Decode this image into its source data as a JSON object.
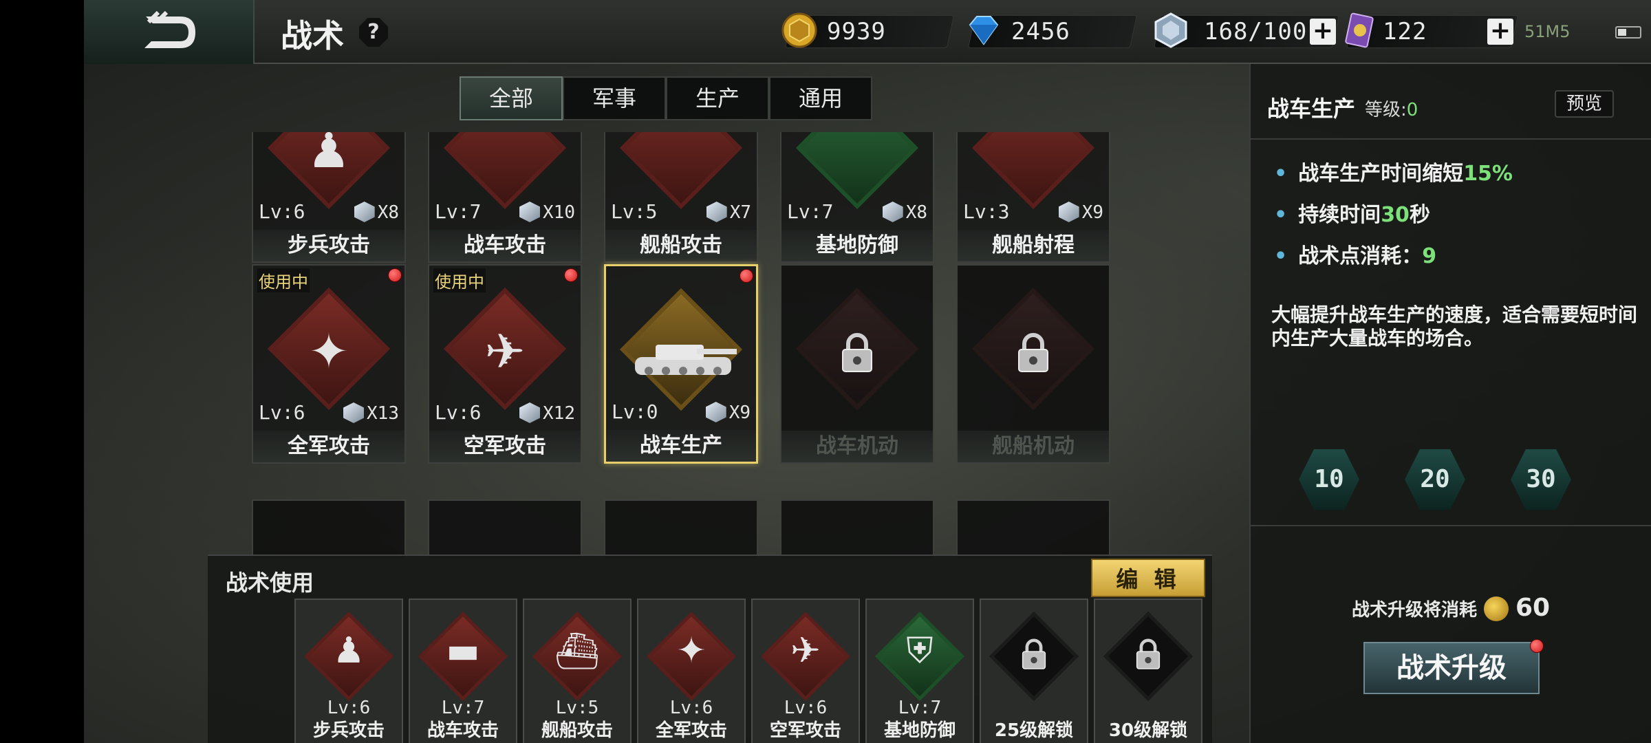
{
  "header": {
    "title": "战术",
    "help": "?",
    "gold": "9939",
    "diamond": "2456",
    "crystal": "168/100",
    "card": "122",
    "plus": "+",
    "network": "51M5"
  },
  "tabs": [
    "全部",
    "军事",
    "生产",
    "通用"
  ],
  "cards_row1": [
    {
      "lv": "Lv:6",
      "cost": "X8",
      "name": "步兵攻击"
    },
    {
      "lv": "Lv:7",
      "cost": "X10",
      "name": "战车攻击"
    },
    {
      "lv": "Lv:5",
      "cost": "X7",
      "name": "舰船攻击"
    },
    {
      "lv": "Lv:7",
      "cost": "X8",
      "name": "基地防御"
    },
    {
      "lv": "Lv:3",
      "cost": "X9",
      "name": "舰船射程"
    }
  ],
  "cards_row2": [
    {
      "lv": "Lv:6",
      "cost": "X13",
      "name": "全军攻击",
      "tag": "使用中"
    },
    {
      "lv": "Lv:6",
      "cost": "X12",
      "name": "空军攻击",
      "tag": "使用中"
    },
    {
      "lv": "Lv:0",
      "cost": "X9",
      "name": "战车生产"
    },
    {
      "name": "战车机动"
    },
    {
      "name": "舰船机动"
    }
  ],
  "dock": {
    "title": "战术使用",
    "edit": "编 辑",
    "slots": [
      {
        "lv": "Lv:6",
        "name": "步兵攻击"
      },
      {
        "lv": "Lv:7",
        "name": "战车攻击"
      },
      {
        "lv": "Lv:5",
        "name": "舰船攻击"
      },
      {
        "lv": "Lv:6",
        "name": "全军攻击"
      },
      {
        "lv": "Lv:6",
        "name": "空军攻击"
      },
      {
        "lv": "Lv:7",
        "name": "基地防御"
      },
      {
        "name": "25级解锁"
      },
      {
        "name": "30级解锁"
      }
    ]
  },
  "panel": {
    "name": "战车生产",
    "level_label": "等级:",
    "level": "0",
    "preview": "预览",
    "l1_pre": "战车生产时间缩短",
    "l1_val": "15%",
    "l2_pre": "持续时间",
    "l2_val": "30",
    "l2_post": "秒",
    "l3_pre": "战术点消耗：",
    "l3_val": "9",
    "desc": "大幅提升战车生产的速度，适合需要短时间内生产大量战车的场合。",
    "milestones": [
      "10",
      "20",
      "30"
    ],
    "cost_label": "战术升级将消耗",
    "cost_value": "60",
    "upgrade": "战术升级"
  }
}
